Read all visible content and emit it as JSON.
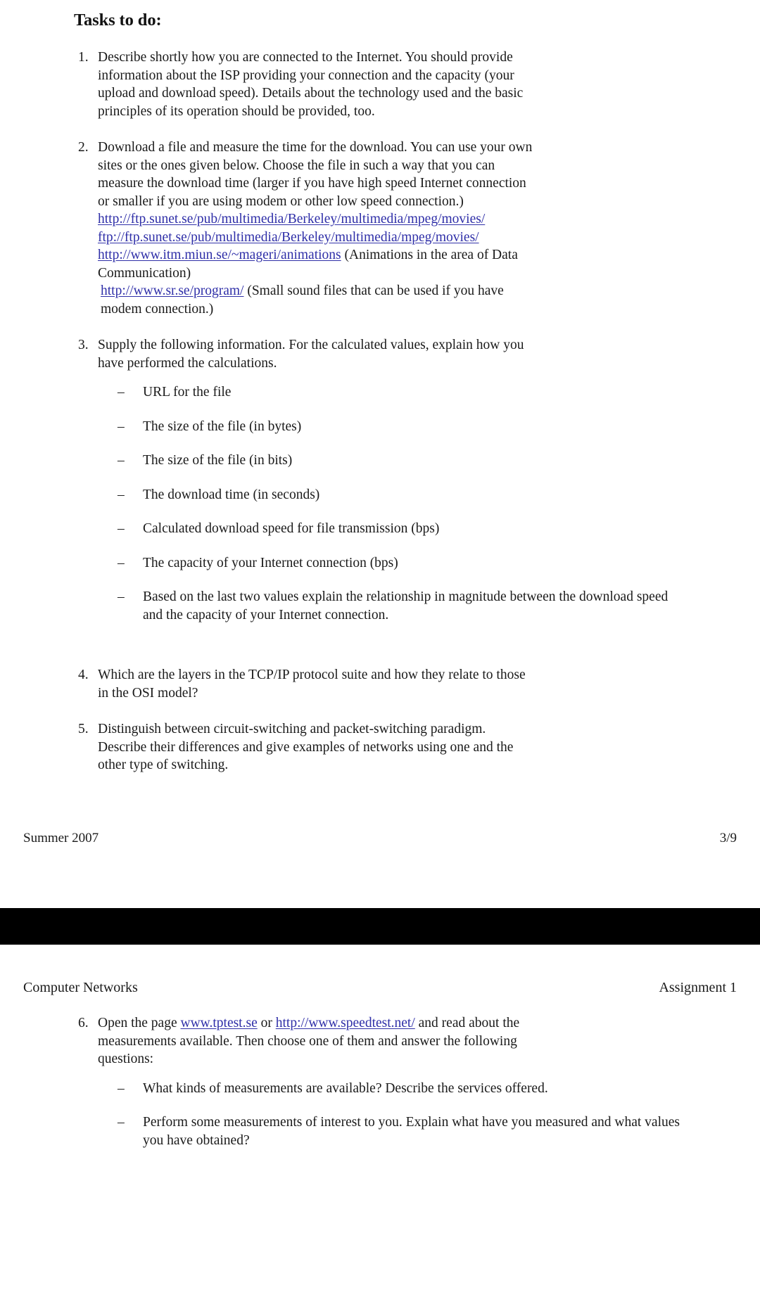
{
  "document": {
    "page_one": {
      "heading": "Tasks to do:",
      "tasks": [
        {
          "number": "1.",
          "lines": [
            "Describe shortly how you are connected to the Internet. You should provide",
            "information about the ISP providing your connection and the capacity (your",
            "upload and download speed). Details about the technology used and the basic",
            "principles of its operation should be provided, too."
          ]
        },
        {
          "number": "2.",
          "lines": [
            "Download a file and measure the time for the download. You can use your own",
            "sites or the ones given below. Choose the file in such a way that you can",
            "measure the download time (larger if you have high speed Internet connection",
            "or smaller if you are using modem or other low speed connection.)"
          ],
          "links": [
            {
              "text": "http://ftp.sunet.se/pub/multimedia/Berkeley/multimedia/mpeg/movies/",
              "trailing": ""
            },
            {
              "text": "ftp://ftp.sunet.se/pub/multimedia/Berkeley/multimedia/mpeg/movies/",
              "trailing": ""
            },
            {
              "text": "http://www.itm.miun.se/~mageri/animations",
              "trailing": " (Animations in the area of Data"
            }
          ],
          "after_link_line": "Communication)",
          "link_last": {
            "text": "http://www.sr.se/program/",
            "trailing": " (Small sound files that can be used if you have"
          },
          "last_line": "modem connection.)"
        },
        {
          "number": "3.",
          "lines": [
            "Supply the following information. For the calculated values, explain how you",
            "have performed the calculations."
          ],
          "sub_items": [
            {
              "dash": "–",
              "text": "URL for the file"
            },
            {
              "dash": "–",
              "text": "The size of the file (in bytes)"
            },
            {
              "dash": "–",
              "text": "The size of the file (in bits)"
            },
            {
              "dash": "–",
              "text": "The download time (in seconds)"
            },
            {
              "dash": "–",
              "text": "Calculated download speed for file transmission (bps)"
            },
            {
              "dash": "–",
              "text": "The capacity of your Internet connection (bps)"
            },
            {
              "dash": "–",
              "text": "Based on the last two values explain the relationship in magnitude between the download speed and the capacity of your Internet connection."
            }
          ]
        },
        {
          "number": "4.",
          "lines": [
            "Which are the layers in the TCP/IP protocol suite and how they relate to those",
            "in the OSI model?"
          ]
        },
        {
          "number": "5.",
          "lines": [
            "Distinguish between circuit-switching and packet-switching paradigm.",
            "Describe their differences and give examples of networks using one and the",
            "other type of switching."
          ]
        }
      ],
      "footer": {
        "left": "Summer 2007",
        "right": "3/9"
      }
    },
    "page_two": {
      "header": {
        "left": "Computer Networks",
        "right": "Assignment 1"
      },
      "task": {
        "number": "6.",
        "line1_pre": "Open the page ",
        "link1": "www.tptest.se",
        "line1_mid": " or ",
        "link2": "http://www.speedtest.net/",
        "line1_post": " and read about the",
        "line2": "measurements available. Then choose one of them and answer the following",
        "line3": "questions:",
        "sub_items": [
          {
            "dash": "–",
            "text": "What kinds of measurements are available? Describe the services offered."
          },
          {
            "dash": "–",
            "text": "Perform some measurements of interest to you. Explain what have you measured and what values you have obtained?"
          }
        ]
      }
    }
  },
  "colors": {
    "link": "#2f2fa8",
    "text": "#1a1a1a",
    "page_break": "#000000",
    "background": "#ffffff"
  }
}
